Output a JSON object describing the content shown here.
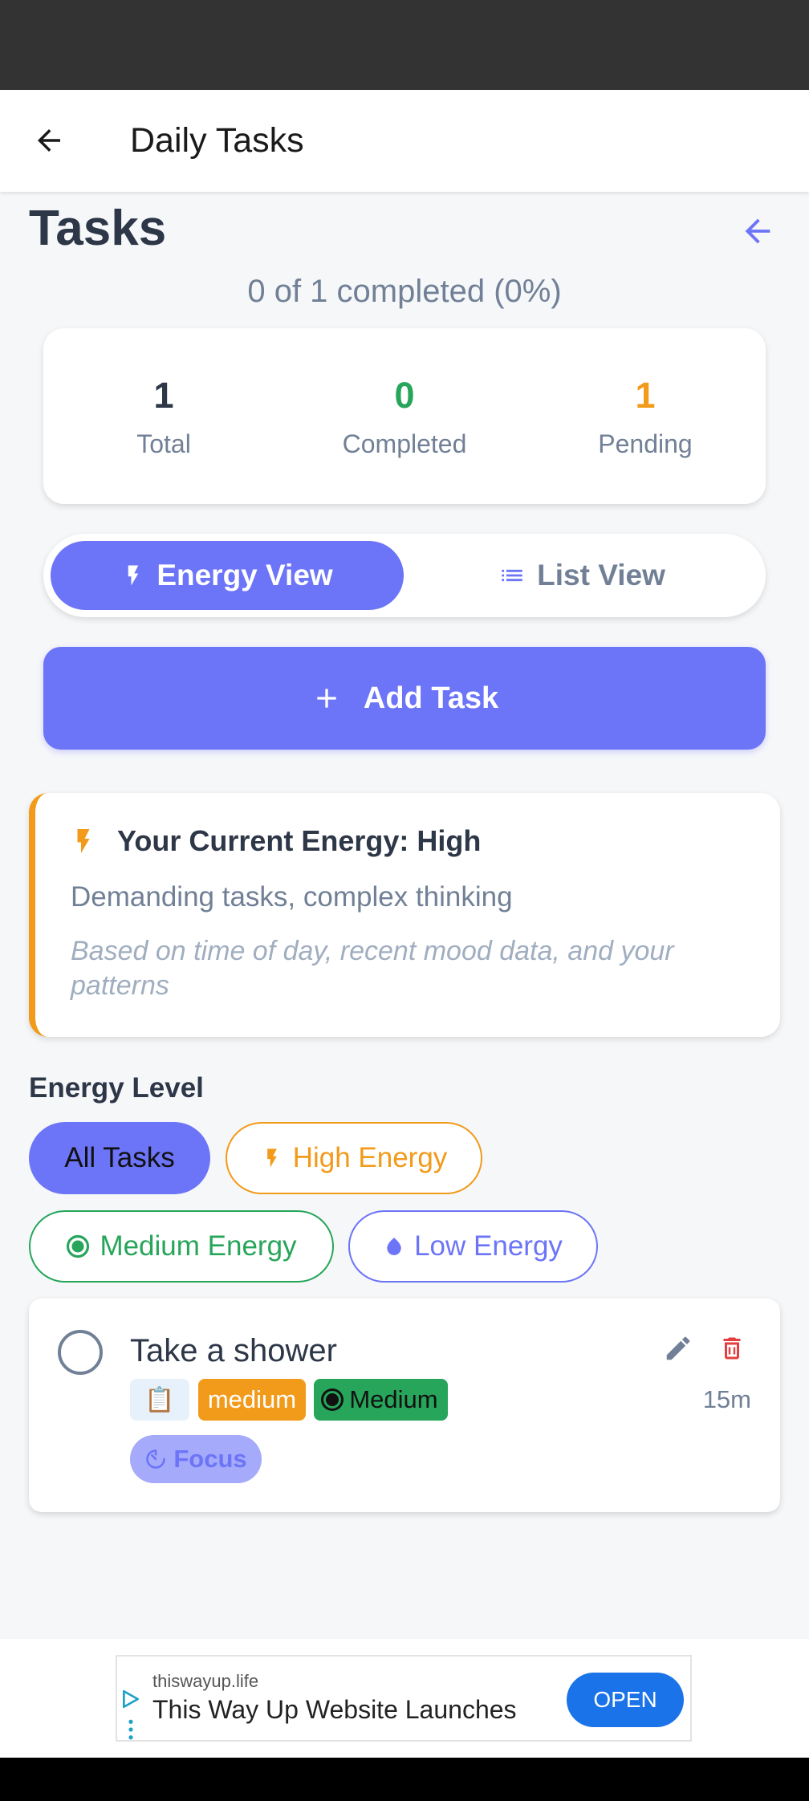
{
  "app_bar": {
    "title": "Daily Tasks"
  },
  "page": {
    "title": "Tasks",
    "progress_text": "0 of 1 completed (0%)"
  },
  "stats": [
    {
      "value": "1",
      "label": "Total",
      "color": "#2d3748"
    },
    {
      "value": "0",
      "label": "Completed",
      "color": "#27a55a"
    },
    {
      "value": "1",
      "label": "Pending",
      "color": "#f29a1a"
    }
  ],
  "view_toggle": {
    "energy_view": "Energy View",
    "list_view": "List View",
    "active": "energy_view"
  },
  "add_task": {
    "label": "Add Task"
  },
  "energy_card": {
    "title": "Your Current Energy: High",
    "description": "Demanding tasks, complex thinking",
    "note": "Based on time of day, recent mood data, and your patterns"
  },
  "energy_filter": {
    "label": "Energy Level",
    "chips": [
      {
        "label": "All Tasks",
        "selected": true
      },
      {
        "label": "High Energy",
        "selected": false
      },
      {
        "label": "Medium Energy",
        "selected": false
      },
      {
        "label": "Low Energy",
        "selected": false
      }
    ]
  },
  "tasks": [
    {
      "title": "Take a shower",
      "category_icon": "📋",
      "priority": "medium",
      "energy": "Medium",
      "duration": "15m",
      "focus_label": "Focus",
      "completed": false
    }
  ],
  "ad": {
    "domain": "thiswayup.life",
    "headline": "This Way Up Website Launches",
    "cta": "OPEN"
  },
  "colors": {
    "accent": "#6c74f7",
    "high": "#f29a1a",
    "medium": "#27a55a",
    "delete": "#e53e3e"
  }
}
